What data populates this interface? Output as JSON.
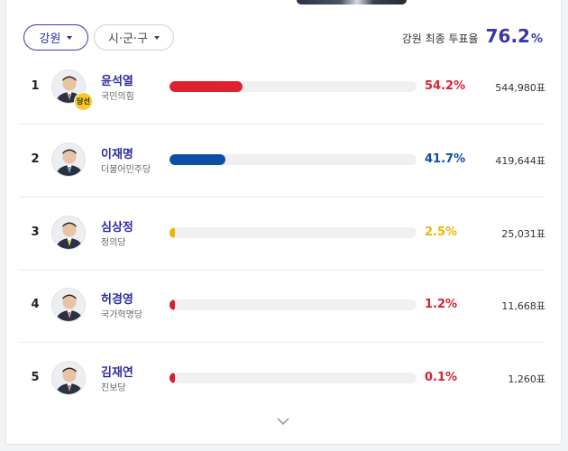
{
  "filters": {
    "region": "강원",
    "district": "시·군·구"
  },
  "turnout": {
    "label": "강원 최종 투표율",
    "value": "76.2",
    "unit": "%"
  },
  "candidates": [
    {
      "rank": "1",
      "name": "윤석열",
      "party": "국민의힘",
      "percent_text": "54.2%",
      "percent": 54.2,
      "votes": "544,980표",
      "color": "#e0202f",
      "winner": true,
      "badge": "당선"
    },
    {
      "rank": "2",
      "name": "이재명",
      "party": "더불어민주당",
      "percent_text": "41.7%",
      "percent": 41.7,
      "votes": "419,644표",
      "color": "#0b4fa5",
      "winner": false
    },
    {
      "rank": "3",
      "name": "심상정",
      "party": "정의당",
      "percent_text": "2.5%",
      "percent": 2.5,
      "votes": "25,031표",
      "color": "#f2b400",
      "winner": false
    },
    {
      "rank": "4",
      "name": "허경영",
      "party": "국가혁명당",
      "percent_text": "1.2%",
      "percent": 1.2,
      "votes": "11,668표",
      "color": "#d3202e",
      "winner": false
    },
    {
      "rank": "5",
      "name": "김재연",
      "party": "진보당",
      "percent_text": "0.1%",
      "percent": 0.1,
      "votes": "1,260표",
      "color": "#d3202e",
      "winner": false
    }
  ],
  "icons": {
    "dropdown_caret": "caret-down-icon",
    "more": "chevron-down-icon"
  }
}
